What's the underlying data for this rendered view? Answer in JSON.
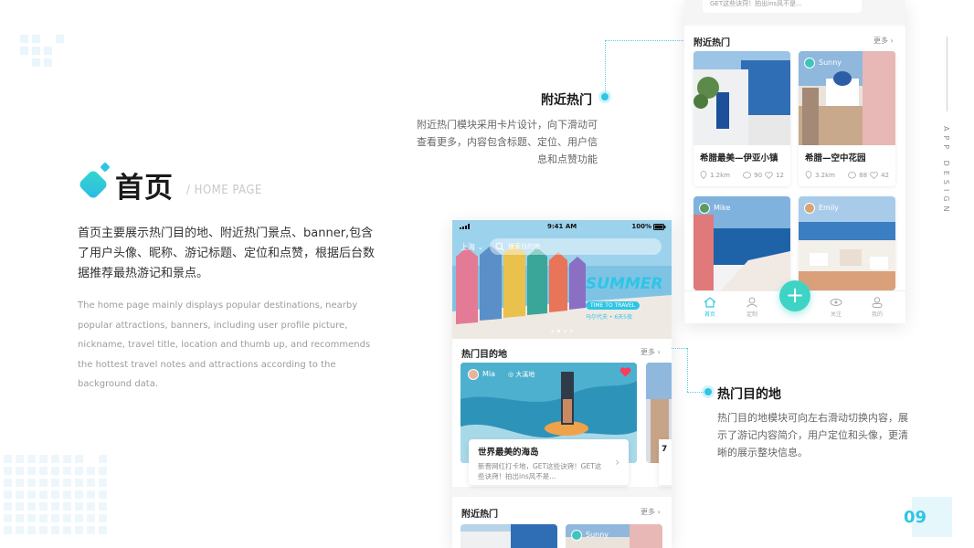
{
  "page": {
    "title_cn": "首页",
    "title_en": "/ HOME PAGE",
    "desc_cn": "首页主要展示热门目的地、附近热门景点、banner,包含了用户头像、昵称、游记标题、定位和点赞，根据后台数据推荐最热游记和景点。",
    "desc_en": "The home page mainly displays popular destinations, nearby popular attractions, banners, including user profile picture, nickname, travel title, location and thumb up, and recommends the hottest travel notes and attractions according to the background data.",
    "side_text": "APP DESIGN",
    "page_number": "09"
  },
  "callouts": {
    "nearby": {
      "title": "附近热门",
      "body": "附近热门模块采用卡片设计，向下滑动可查看更多，内容包含标题、定位、用户信息和点赞功能"
    },
    "hot": {
      "title": "热门目的地",
      "body": "热门目的地模块可向左右滑动切换内容，展示了游记内容简介，用户定位和头像，更清晰的展示整块信息。"
    }
  },
  "phone1": {
    "status": {
      "time": "9:41 AM",
      "battery": "100%"
    },
    "city": "上海",
    "search_placeholder": "搜索目的地",
    "banner_text": {
      "main": "SUMMER",
      "sub": "TIME TO TRAVEL",
      "caption": "马尔代夫 • 6天5夜"
    },
    "section1_title": "热门目的地",
    "more": "更多",
    "hot_card": {
      "user": "Mia",
      "location": "大溪地",
      "title": "世界最美的海岛",
      "desc": "新晋网红打卡地，GET这些诀窍！GET这些诀窍！拍出ins风不是..."
    },
    "peek_card": {
      "title": "7",
      "desc": "马...\n坐..."
    },
    "section2_title": "附近热门",
    "section2_user": "Sunny"
  },
  "phone2": {
    "top_snippet": "GET这些诀窍！拍出ins风不是...",
    "section_title": "附近热门",
    "more": "更多",
    "cards": [
      {
        "title": "希腊最美—伊亚小镇",
        "distance": "1.2km",
        "comments": "90",
        "likes": "12",
        "user": ""
      },
      {
        "title": "希腊—空中花园",
        "distance": "3.2km",
        "comments": "88",
        "likes": "42",
        "user": "Sunny"
      },
      {
        "title": "",
        "distance": "",
        "comments": "",
        "likes": "",
        "user": "Mike"
      },
      {
        "title": "",
        "distance": "",
        "comments": "",
        "likes": "",
        "user": "Emily"
      }
    ],
    "tabs": [
      "首页",
      "定制",
      "关注",
      "我的"
    ],
    "fab_label": "+"
  },
  "colors": {
    "accent": "#2ec5e6",
    "fab": "#3fd3c6",
    "heart": "#ff3b5c"
  },
  "icons": [
    "diamond-logo-icon",
    "search-icon",
    "heart-icon",
    "location-icon",
    "comment-icon",
    "like-icon",
    "home-icon",
    "user-icon",
    "eye-icon",
    "profile-icon",
    "plus-icon",
    "chevron-right-icon"
  ]
}
